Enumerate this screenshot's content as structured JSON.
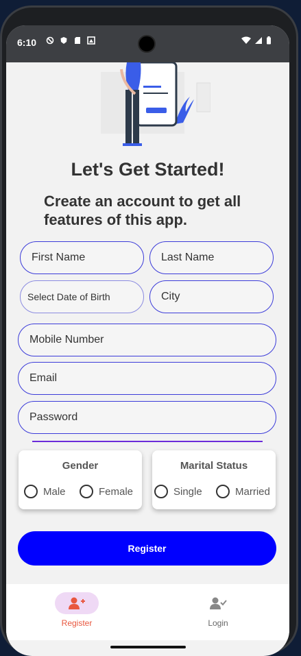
{
  "status_bar": {
    "time": "6:10"
  },
  "header": {
    "title": "Let's Get Started!",
    "subtitle": "Create an account to get all features of this app."
  },
  "form": {
    "first_name": {
      "placeholder": "First Name"
    },
    "last_name": {
      "placeholder": "Last Name"
    },
    "dob": {
      "placeholder": "Select Date of Birth"
    },
    "city": {
      "placeholder": "City"
    },
    "mobile": {
      "placeholder": "Mobile Number"
    },
    "email": {
      "placeholder": "Email"
    },
    "password": {
      "placeholder": "Password"
    }
  },
  "gender": {
    "title": "Gender",
    "options": [
      "Male",
      "Female"
    ]
  },
  "marital_status": {
    "title": "Marital Status",
    "options": [
      "Single",
      "Married"
    ]
  },
  "register_button": {
    "label": "Register"
  },
  "bottom_nav": {
    "items": [
      {
        "label": "Register",
        "icon": "add-person-icon",
        "active": true
      },
      {
        "label": "Login",
        "icon": "person-check-icon",
        "active": false
      }
    ]
  },
  "colors": {
    "accent": "#0000ff",
    "field_border": "#3b3bd9",
    "nav_active": "#e8573f",
    "nav_active_pill": "#efd9f5",
    "divider": "#6a2bd9"
  }
}
